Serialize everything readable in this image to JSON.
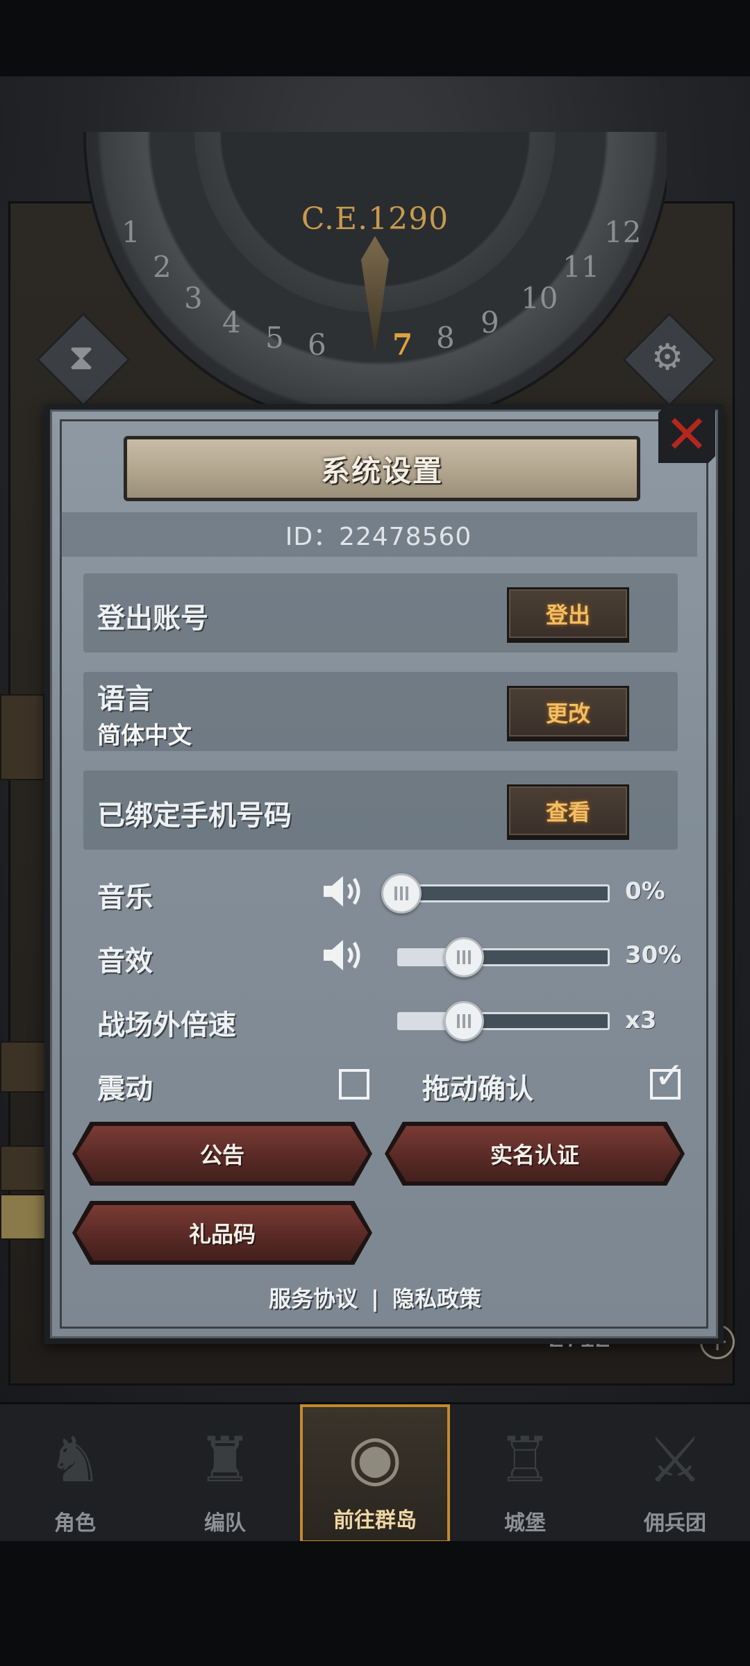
{
  "game": {
    "year": "C.E.1290",
    "dial_numbers": [
      "1",
      "2",
      "3",
      "4",
      "5",
      "6",
      "7",
      "8",
      "9",
      "10",
      "11",
      "12"
    ],
    "active_number": "7",
    "resource_value": "2712"
  },
  "dialog": {
    "title": "系统设置",
    "id_text": "ID：22478560",
    "logout": {
      "label": "登出账号",
      "button": "登出"
    },
    "language": {
      "label": "语言",
      "value": "简体中文",
      "button": "更改"
    },
    "phone": {
      "label": "已绑定手机号码",
      "button": "查看"
    },
    "music": {
      "label": "音乐",
      "value_text": "0%",
      "level": 0
    },
    "sfx": {
      "label": "音效",
      "value_text": "30%",
      "level": 0.3
    },
    "speed": {
      "label": "战场外倍速",
      "value_text": "x3",
      "level": 0.3
    },
    "vibration": {
      "label": "震动",
      "checked": false
    },
    "drag_confirm": {
      "label": "拖动确认",
      "checked": true
    },
    "buttons": {
      "notice": "公告",
      "realname": "实名认证",
      "gift_code": "礼品码"
    },
    "links": {
      "service": "服务协议",
      "separator": "|",
      "privacy": "隐私政策"
    }
  },
  "nav": {
    "items": [
      {
        "label": "角色",
        "icon": "knight-icon"
      },
      {
        "label": "编队",
        "icon": "team-icon"
      },
      {
        "label": "前往群岛",
        "icon": "globe-icon",
        "active": true
      },
      {
        "label": "城堡",
        "icon": "castle-icon"
      },
      {
        "label": "佣兵团",
        "icon": "mercenary-icon"
      }
    ]
  },
  "colors": {
    "accent_gold": "#f2bf66",
    "panel": "#838e98",
    "close_red": "#b3271f",
    "nav_active_border": "#c48a2c"
  }
}
